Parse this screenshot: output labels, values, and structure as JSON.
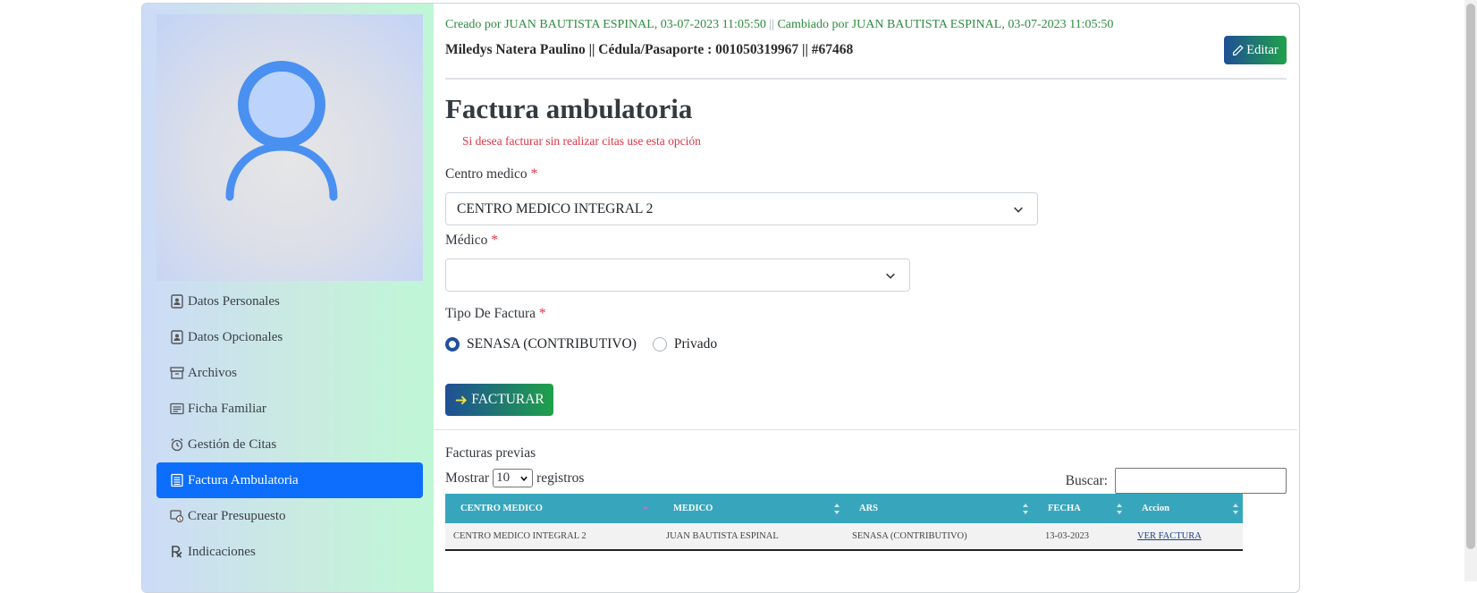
{
  "header": {
    "created_text": "Creado por JUAN BAUTISTA ESPINAL, 03-07-2023 11:05:50",
    "separator": "||",
    "changed_text": "Cambiado por JUAN BAUTISTA ESPINAL, 03-07-2023 11:05:50",
    "patient_line": "Miledys Natera Paulino || Cédula/Pasaporte : 001050319967 || #67468",
    "edit_label": "Editar"
  },
  "sidebar": {
    "items": [
      {
        "label": "Datos Personales",
        "icon": "id-card-icon"
      },
      {
        "label": "Datos Opcionales",
        "icon": "id-card-icon"
      },
      {
        "label": "Archivos",
        "icon": "archive-icon"
      },
      {
        "label": "Ficha Familiar",
        "icon": "card-text-icon"
      },
      {
        "label": "Gestión de Citas",
        "icon": "alarm-icon"
      },
      {
        "label": "Factura Ambulatoria",
        "icon": "receipt-icon",
        "active": true
      },
      {
        "label": "Crear Presupuesto",
        "icon": "budget-icon"
      },
      {
        "label": "Indicaciones",
        "icon": "prescription-icon"
      }
    ]
  },
  "form": {
    "title": "Factura ambulatoria",
    "hint": "Si desea facturar sin realizar citas use esta opción",
    "centro_label": "Centro medico",
    "centro_value": "CENTRO MEDICO INTEGRAL 2",
    "medico_label": "Médico",
    "medico_value": "",
    "tipo_label": "Tipo De Factura",
    "required_mark": "*",
    "radio_options": [
      "SENASA (CONTRIBUTIVO)",
      "Privado"
    ],
    "radio_selected": "SENASA (CONTRIBUTIVO)",
    "submit_label": "FACTURAR"
  },
  "previous": {
    "title": "Facturas previas",
    "show_prefix": "Mostrar",
    "page_length": "10",
    "show_suffix": "registros",
    "search_label": "Buscar:",
    "columns": [
      "CENTRO MEDICO",
      "MEDICO",
      "ARS",
      "FECHA",
      "Accion"
    ],
    "rows": [
      [
        "CENTRO MEDICO INTEGRAL 2",
        "JUAN BAUTISTA ESPINAL",
        "SENASA (CONTRIBUTIVO)",
        "13-03-2023",
        "VER FACTURA"
      ]
    ]
  },
  "colors": {
    "accent_blue": "#0d6efd",
    "gradient_start": "#1f4f96",
    "gradient_end": "#1fa14a",
    "table_header": "#37a6bd",
    "meta_green": "#2e8b3e",
    "required_red": "#dc3545"
  }
}
